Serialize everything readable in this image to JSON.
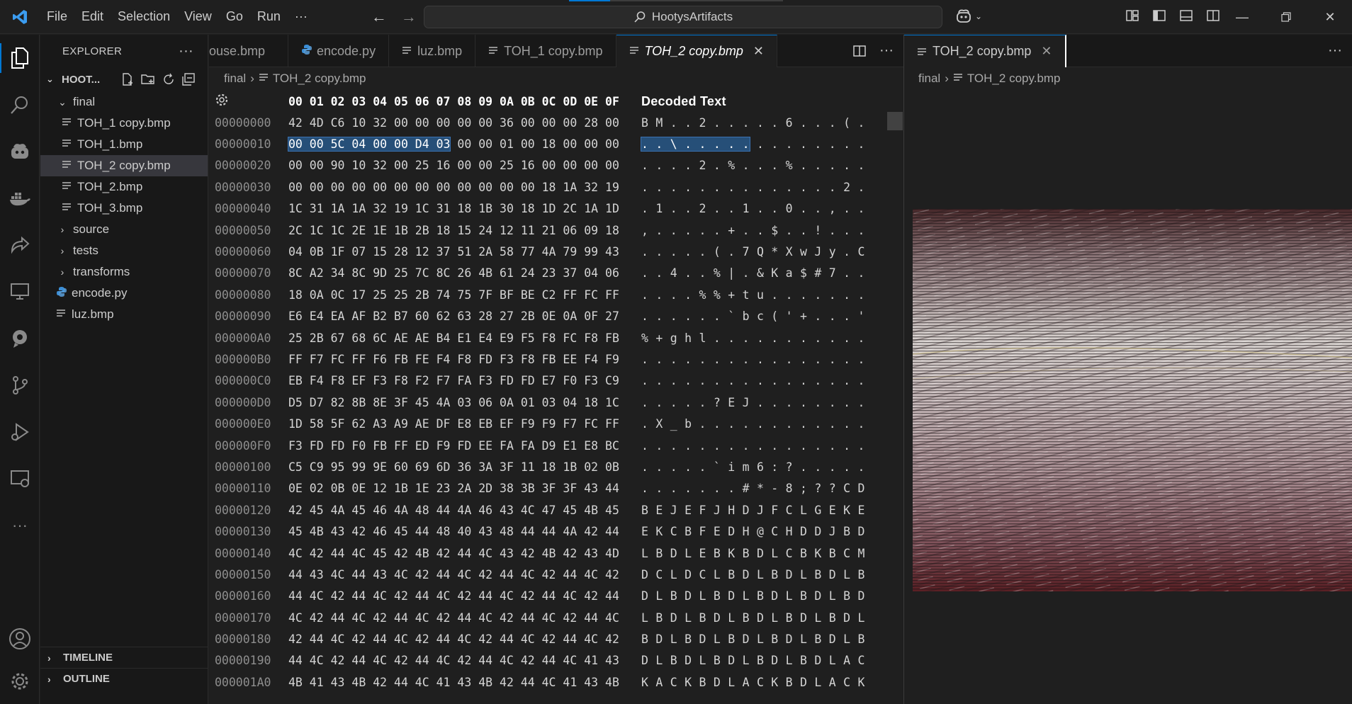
{
  "titlebar": {
    "menu": [
      "File",
      "Edit",
      "Selection",
      "View",
      "Go",
      "Run",
      "···"
    ],
    "search_text": "HootysArtifacts"
  },
  "sidebar": {
    "title": "EXPLORER",
    "root_folder": "HOOT...",
    "tree": [
      {
        "label": "final",
        "type": "folder-open",
        "depth": 1
      },
      {
        "label": "TOH_1 copy.bmp",
        "type": "bmp",
        "depth": 2
      },
      {
        "label": "TOH_1.bmp",
        "type": "bmp",
        "depth": 2
      },
      {
        "label": "TOH_2 copy.bmp",
        "type": "bmp",
        "depth": 2,
        "selected": true
      },
      {
        "label": "TOH_2.bmp",
        "type": "bmp",
        "depth": 2
      },
      {
        "label": "TOH_3.bmp",
        "type": "bmp",
        "depth": 2
      },
      {
        "label": "source",
        "type": "folder",
        "depth": 1
      },
      {
        "label": "tests",
        "type": "folder",
        "depth": 1
      },
      {
        "label": "transforms",
        "type": "folder",
        "depth": 1
      },
      {
        "label": "encode.py",
        "type": "py",
        "depth": 1
      },
      {
        "label": "luz.bmp",
        "type": "bmp",
        "depth": 1
      }
    ],
    "timeline": "TIMELINE",
    "outline": "OUTLINE"
  },
  "editor1": {
    "tabs": [
      {
        "label": "ouse.bmp",
        "type": "bmp"
      },
      {
        "label": "encode.py",
        "type": "py"
      },
      {
        "label": "luz.bmp",
        "type": "bmp"
      },
      {
        "label": "TOH_1 copy.bmp",
        "type": "bmp"
      },
      {
        "label": "TOH_2 copy.bmp",
        "type": "bmp",
        "active": true
      }
    ],
    "breadcrumb": {
      "folder": "final",
      "file": "TOH_2 copy.bmp"
    },
    "hex": {
      "header_bytes": "00 01 02 03 04 05 06 07 08 09 0A 0B 0C 0D 0E 0F",
      "decoded_title": "Decoded Text",
      "selected_bytes": "00 00 5C 04 00 00 D4 03",
      "selected_ascii": ". . \\ . . . . .",
      "rows": [
        {
          "addr": "00000000",
          "bytes": "42 4D C6 10 32 00 00 00 00 00 36 00 00 00 28 00",
          "ascii": "B M . . 2 . . . . . 6 . . . ( ."
        },
        {
          "addr": "00000010",
          "bytes": " 00 00 01 00 18 00 00 00",
          "ascii": " . . . . . . . ."
        },
        {
          "addr": "00000020",
          "bytes": "00 00 90 10 32 00 25 16 00 00 25 16 00 00 00 00",
          "ascii": ". . . . 2 . % . . . % . . . . ."
        },
        {
          "addr": "00000030",
          "bytes": "00 00 00 00 00 00 00 00 00 00 00 00 18 1A 32 19",
          "ascii": ". . . . . . . . . . . . . . 2 ."
        },
        {
          "addr": "00000040",
          "bytes": "1C 31 1A 1A 32 19 1C 31 18 1B 30 18 1D 2C 1A 1D",
          "ascii": ". 1 . . 2 . . 1 . . 0 . . , . ."
        },
        {
          "addr": "00000050",
          "bytes": "2C 1C 1C 2E 1E 1B 2B 18 15 24 12 11 21 06 09 18",
          "ascii": ", . . . . . + . . $ . . ! . . ."
        },
        {
          "addr": "00000060",
          "bytes": "04 0B 1F 07 15 28 12 37 51 2A 58 77 4A 79 99 43",
          "ascii": ". . . . . ( . 7 Q * X w J y . C"
        },
        {
          "addr": "00000070",
          "bytes": "8C A2 34 8C 9D 25 7C 8C 26 4B 61 24 23 37 04 06",
          "ascii": ". . 4 . . % | . & K a $ # 7 . ."
        },
        {
          "addr": "00000080",
          "bytes": "18 0A 0C 17 25 25 2B 74 75 7F BF BE C2 FF FC FF",
          "ascii": ". . . . % % + t u . . . . . . ."
        },
        {
          "addr": "00000090",
          "bytes": "E6 E4 EA AF B2 B7 60 62 63 28 27 2B 0E 0A 0F 27",
          "ascii": ". . . . . . ` b c ( ' + . . . '"
        },
        {
          "addr": "000000A0",
          "bytes": "25 2B 67 68 6C AE AE B4 E1 E4 E9 F5 F8 FC F8 FB",
          "ascii": "% + g h l . . . . . . . . . . ."
        },
        {
          "addr": "000000B0",
          "bytes": "FF F7 FC FF F6 FB FE F4 F8 FD F3 F8 FB EE F4 F9",
          "ascii": ". . . . . . . . . . . . . . . ."
        },
        {
          "addr": "000000C0",
          "bytes": "EB F4 F8 EF F3 F8 F2 F7 FA F3 FD FD E7 F0 F3 C9",
          "ascii": ". . . . . . . . . . . . . . . ."
        },
        {
          "addr": "000000D0",
          "bytes": "D5 D7 82 8B 8E 3F 45 4A 03 06 0A 01 03 04 18 1C",
          "ascii": ". . . . . ? E J . . . . . . . ."
        },
        {
          "addr": "000000E0",
          "bytes": "1D 58 5F 62 A3 A9 AE DF E8 EB EF F9 F9 F7 FC FF",
          "ascii": ". X _ b . . . . . . . . . . . ."
        },
        {
          "addr": "000000F0",
          "bytes": "F3 FD FD F0 FB FF ED F9 FD EE FA FA D9 E1 E8 BC",
          "ascii": ". . . . . . . . . . . . . . . ."
        },
        {
          "addr": "00000100",
          "bytes": "C5 C9 95 99 9E 60 69 6D 36 3A 3F 11 18 1B 02 0B",
          "ascii": ". . . . . ` i m 6 : ? . . . . ."
        },
        {
          "addr": "00000110",
          "bytes": "0E 02 0B 0E 12 1B 1E 23 2A 2D 38 3B 3F 3F 43 44",
          "ascii": ". . . . . . . # * - 8 ; ? ? C D"
        },
        {
          "addr": "00000120",
          "bytes": "42 45 4A 45 46 4A 48 44 4A 46 43 4C 47 45 4B 45",
          "ascii": "B E J E F J H D J F C L G E K E"
        },
        {
          "addr": "00000130",
          "bytes": "45 4B 43 42 46 45 44 48 40 43 48 44 44 4A 42 44",
          "ascii": "E K C B F E D H @ C H D D J B D"
        },
        {
          "addr": "00000140",
          "bytes": "4C 42 44 4C 45 42 4B 42 44 4C 43 42 4B 42 43 4D",
          "ascii": "L B D L E B K B D L C B K B C M"
        },
        {
          "addr": "00000150",
          "bytes": "44 43 4C 44 43 4C 42 44 4C 42 44 4C 42 44 4C 42",
          "ascii": "D C L D C L B D L B D L B D L B"
        },
        {
          "addr": "00000160",
          "bytes": "44 4C 42 44 4C 42 44 4C 42 44 4C 42 44 4C 42 44",
          "ascii": "D L B D L B D L B D L B D L B D"
        },
        {
          "addr": "00000170",
          "bytes": "4C 42 44 4C 42 44 4C 42 44 4C 42 44 4C 42 44 4C",
          "ascii": "L B D L B D L B D L B D L B D L"
        },
        {
          "addr": "00000180",
          "bytes": "42 44 4C 42 44 4C 42 44 4C 42 44 4C 42 44 4C 42",
          "ascii": "B D L B D L B D L B D L B D L B"
        },
        {
          "addr": "00000190",
          "bytes": "44 4C 42 44 4C 42 44 4C 42 44 4C 42 44 4C 41 43",
          "ascii": "D L B D L B D L B D L B D L A C"
        },
        {
          "addr": "000001A0",
          "bytes": "4B 41 43 4B 42 44 4C 41 43 4B 42 44 4C 41 43 4B",
          "ascii": "K A C K B D L A C K B D L A C K"
        }
      ]
    }
  },
  "editor2": {
    "tab": "TOH_2 copy.bmp",
    "breadcrumb": {
      "folder": "final",
      "file": "TOH_2 copy.bmp"
    }
  },
  "colors": {
    "accent": "#0078d4",
    "selection": "#264f78",
    "background": "#1f1f1f",
    "sidebar": "#181818"
  }
}
